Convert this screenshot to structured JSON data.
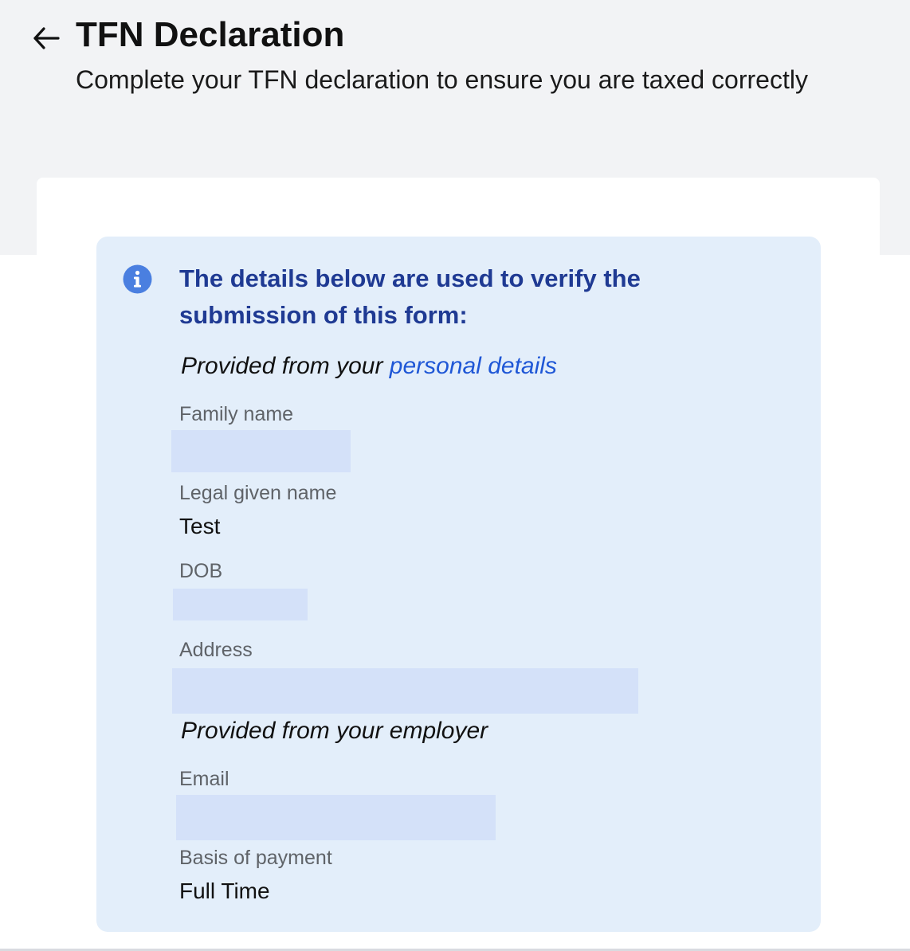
{
  "header": {
    "back_icon": "arrow-left-icon",
    "title": "TFN Declaration",
    "subtitle": "Complete your TFN declaration to ensure you are taxed correctly"
  },
  "info": {
    "icon": "info-circle-icon",
    "heading": "The details below are used to verify the submission of this form:",
    "personal_caption_prefix": "Provided from your",
    "personal_details_link": "personal details",
    "employer_caption": "Provided from your employer"
  },
  "fields": {
    "family_name": {
      "label": "Family name"
    },
    "legal_given_name": {
      "label": "Legal given name",
      "value": "Test"
    },
    "dob": {
      "label": "DOB"
    },
    "address": {
      "label": "Address"
    },
    "email": {
      "label": "Email"
    },
    "basis_of_payment": {
      "label": "Basis of payment",
      "value": "Full Time"
    }
  },
  "colors": {
    "page_background": "#f2f3f5",
    "info_background": "#e3eefa",
    "heading_blue": "#1f3a93",
    "link_blue": "#1f57d6",
    "icon_blue": "#4a7fe0",
    "redaction": "#d4e1f9"
  }
}
